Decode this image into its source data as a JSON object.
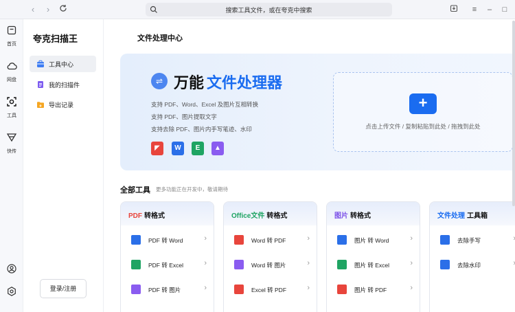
{
  "search": {
    "text": "搜索工具文件，或在夸克中搜索"
  },
  "rail": [
    {
      "label": "首页",
      "icon": "home-icon"
    },
    {
      "label": "网盘",
      "icon": "cloud-icon"
    },
    {
      "label": "工具",
      "icon": "scan-icon"
    },
    {
      "label": "快传",
      "icon": "send-icon"
    }
  ],
  "sidebar": {
    "brand": "夸克扫描王",
    "items": [
      {
        "label": "工具中心",
        "icon": "toolbox-icon"
      },
      {
        "label": "我的扫描件",
        "icon": "document-icon"
      },
      {
        "label": "导出记录",
        "icon": "folder-icon"
      }
    ],
    "login": "登录/注册"
  },
  "main": {
    "title": "文件处理中心",
    "hero": {
      "title_a": "万能",
      "title_b": "文件处理器",
      "lines": [
        "支持 PDF、Word、Excel 及图片互相转换",
        "支持 PDF、图片提取文字",
        "支持去除 PDF、图片内手写笔迹、水印"
      ],
      "formats": [
        {
          "icon": "pdf-icon",
          "glyph": "◤",
          "color": "#e8453c"
        },
        {
          "icon": "word-icon",
          "glyph": "W",
          "color": "#2b6fe8"
        },
        {
          "icon": "excel-icon",
          "glyph": "E",
          "color": "#1fa463"
        },
        {
          "icon": "image-icon",
          "glyph": "▲",
          "color": "#8a5cf0"
        }
      ],
      "upload_text": "点击上传文件 / 复制粘贴到此处 / 拖拽到此处"
    },
    "section": {
      "title": "全部工具",
      "subtitle": "更多功能正在开发中，敬请期待"
    },
    "cards": [
      {
        "hl": "PDF",
        "hl_color": "#e8453c",
        "rest": "转格式",
        "rows": [
          {
            "label": "PDF 转 Word",
            "color": "#2b6fe8"
          },
          {
            "label": "PDF 转 Excel",
            "color": "#1fa463"
          },
          {
            "label": "PDF 转 图片",
            "color": "#8a5cf0"
          }
        ]
      },
      {
        "hl": "Office文件",
        "hl_color": "#1fa463",
        "rest": "转格式",
        "rows": [
          {
            "label": "Word 转 PDF",
            "color": "#e8453c"
          },
          {
            "label": "Word 转 图片",
            "color": "#8a5cf0"
          },
          {
            "label": "Excel 转 PDF",
            "color": "#e8453c"
          }
        ]
      },
      {
        "hl": "图片",
        "hl_color": "#7a4ee8",
        "rest": "转格式",
        "rows": [
          {
            "label": "图片 转 Word",
            "color": "#2b6fe8"
          },
          {
            "label": "图片 转 Excel",
            "color": "#1fa463"
          },
          {
            "label": "图片 转 PDF",
            "color": "#e8453c"
          }
        ]
      },
      {
        "hl": "文件处理",
        "hl_color": "#1a6cf0",
        "rest": "工具箱",
        "rows": [
          {
            "label": "去除手写",
            "color": "#2b6fe8"
          },
          {
            "label": "去除水印",
            "color": "#2b6fe8"
          }
        ]
      }
    ]
  }
}
